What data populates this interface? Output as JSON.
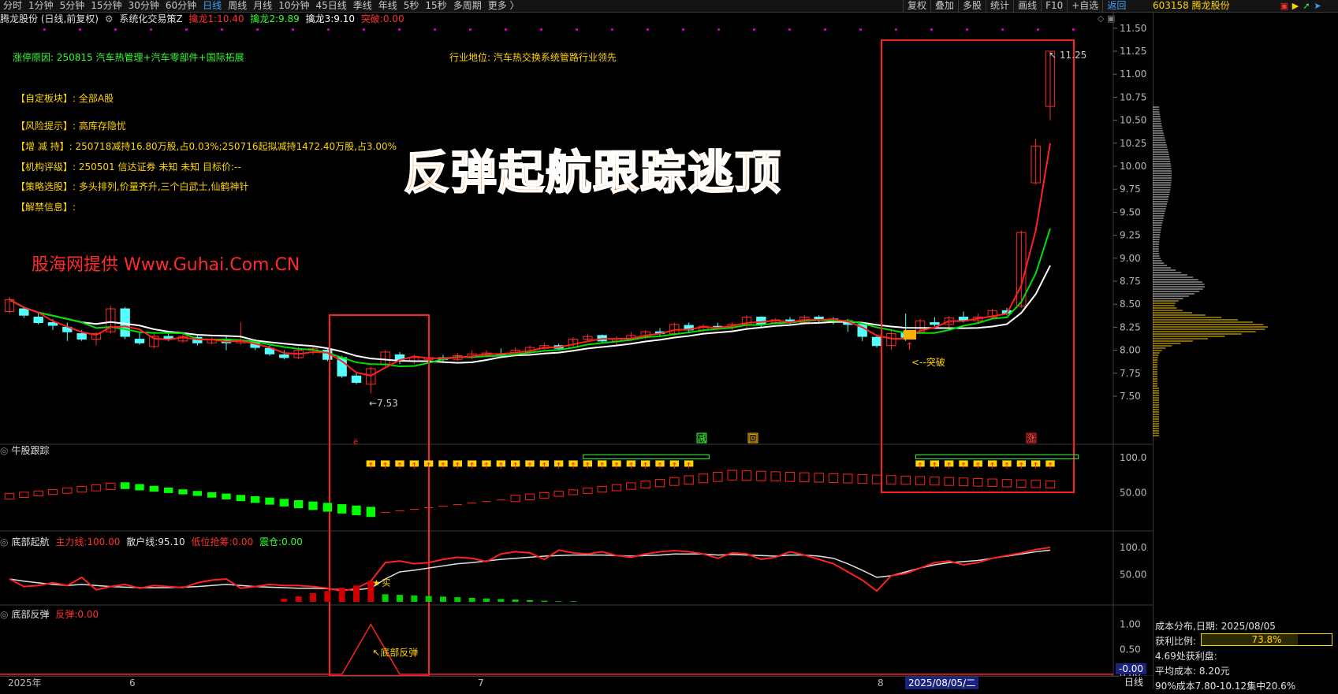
{
  "toolbar": {
    "periods": [
      "分时",
      "1分钟",
      "5分钟",
      "15分钟",
      "30分钟",
      "60分钟",
      "日线",
      "周线",
      "月线",
      "10分钟",
      "45日线",
      "季线",
      "年线",
      "5秒",
      "15秒",
      "多周期",
      "更多 〉"
    ],
    "active_period": "日线",
    "buttons": [
      "复权",
      "叠加",
      "多股",
      "统计",
      "画线",
      "F10",
      "+自选",
      "返回"
    ],
    "stock_code": "603158 腾龙股份"
  },
  "header": {
    "stock": "腾龙股份 (日线,前复权)",
    "formula": "系统化交易策Z",
    "l1_label": "擒龙1:",
    "l1_value": "10.40",
    "l2_label": "擒龙2:",
    "l2_value": "9.89",
    "l3_label": "擒龙3:",
    "l3_value": "9.10",
    "break_label": "突破:",
    "break_value": "0.00"
  },
  "info": {
    "reason": "涨停原因: 250815 汽车热管理+汽车零部件+国际拓展",
    "industry": "行业地位: 汽车热交换系统管路行业领先",
    "sector_label": "【自定板块】:",
    "sector": "全部A股",
    "risk_label": "【风险提示】:",
    "risk": "高库存隐忧",
    "holding_label": "【增 减 持】:",
    "holding": "250718减持16.80万股,占0.03%;250716起拟减持1472.40万股,占3.00%",
    "rating_label": "【机构评级】:",
    "rating": "250501 信达证券 未知 未知 目标价:--",
    "strategy_label": "【策略选股】:",
    "strategy": "多头排列,价量齐升,三个白武士,仙鹤神针",
    "unlock_label": "【解禁信息】:",
    "unlock": ""
  },
  "big_title": "反弹起航跟踪逃顶",
  "watermark": "股海网提供 Www.Guhai.Com.CN",
  "annotations": {
    "low": "←7.53",
    "high": "11.25",
    "breakout": "<--突破",
    "sig_reduce": "减",
    "sig_hui": "回",
    "sig_rise": "涨",
    "bottom_buy": "买",
    "bottom_rebound": "底部反弹"
  },
  "price_axis": [
    "11.50",
    "11.25",
    "11.00",
    "10.75",
    "10.50",
    "10.25",
    "10.00",
    "9.75",
    "9.50",
    "9.25",
    "9.00",
    "8.75",
    "8.50",
    "8.25",
    "8.00",
    "7.75",
    "7.50"
  ],
  "panels": {
    "p2": {
      "title": "牛股跟踪",
      "axis": [
        "100.0",
        "50.00"
      ]
    },
    "p3": {
      "title": "底部起航",
      "main_label": "主力线:",
      "main_value": "100.00",
      "retail_label": "散户线:",
      "retail_value": "95.10",
      "low_label": "低位抢筹:",
      "low_value": "0.00",
      "shake_label": "震仓:",
      "shake_value": "0.00",
      "axis": [
        "100.0",
        "50.00"
      ]
    },
    "p4": {
      "title": "底部反弹",
      "rebound_label": "反弹:",
      "rebound_value": "0.00",
      "axis": [
        "1.00",
        "0.50",
        "0.00"
      ]
    }
  },
  "current_value": "-0.00",
  "dates": {
    "d1": "2025年",
    "d2": "6",
    "d3": "7",
    "d4": "8",
    "selected": "2025/08/05/二",
    "timeframe": "日线"
  },
  "cost": {
    "title": "成本分布,日期:",
    "date": "2025/08/05",
    "profit_label": "获利比例:",
    "profit_value": "73.8%",
    "profit_ratio": 0.738,
    "profit_line": "4.69处获利盘:",
    "avg_label": "平均成本:",
    "avg_value": "8.20元",
    "range_line": "90%成本7.80-10.12集中20.6%"
  },
  "colors": {
    "up": "#ff2b2b",
    "down": "#54ffff",
    "ma_white": "#ffffff",
    "ma_green": "#00e000",
    "ma_red": "#ff2020",
    "yellow": "#ffd400",
    "green_bar": "#00ff00"
  },
  "price_ylim": [
    7.2,
    11.55
  ],
  "candles": [
    [
      8.42,
      8.55,
      8.58,
      8.4
    ],
    [
      8.45,
      8.38,
      8.47,
      8.35
    ],
    [
      8.36,
      8.3,
      8.4,
      8.28
    ],
    [
      8.3,
      8.27,
      8.34,
      8.22
    ],
    [
      8.25,
      8.2,
      8.3,
      8.1
    ],
    [
      8.18,
      8.12,
      8.22,
      8.1
    ],
    [
      8.12,
      8.18,
      8.2,
      8.05
    ],
    [
      8.2,
      8.45,
      8.48,
      8.18
    ],
    [
      8.45,
      8.15,
      8.47,
      8.12
    ],
    [
      8.12,
      8.08,
      8.2,
      8.06
    ],
    [
      8.04,
      8.15,
      8.18,
      8.02
    ],
    [
      8.15,
      8.12,
      8.18,
      8.1
    ],
    [
      8.1,
      8.15,
      8.18,
      8.08
    ],
    [
      8.14,
      8.08,
      8.16,
      8.05
    ],
    [
      8.08,
      8.12,
      8.14,
      8.06
    ],
    [
      8.12,
      8.08,
      8.15,
      8.0
    ],
    [
      8.08,
      8.1,
      8.3,
      8.06
    ],
    [
      8.1,
      8.03,
      8.12,
      8.0
    ],
    [
      8.02,
      7.96,
      8.05,
      7.94
    ],
    [
      7.95,
      7.92,
      8.0,
      7.9
    ],
    [
      7.92,
      8.0,
      8.04,
      7.9
    ],
    [
      8.0,
      8.02,
      8.05,
      7.95
    ],
    [
      8.0,
      7.9,
      8.02,
      7.88
    ],
    [
      7.92,
      7.72,
      7.94,
      7.7
    ],
    [
      7.72,
      7.65,
      7.75,
      7.63
    ],
    [
      7.63,
      7.8,
      7.82,
      7.53
    ],
    [
      7.85,
      7.98,
      8.0,
      7.82
    ],
    [
      7.95,
      7.9,
      7.98,
      7.85
    ],
    [
      7.88,
      7.92,
      7.95,
      7.85
    ],
    [
      7.9,
      7.92,
      7.96,
      7.88
    ],
    [
      7.92,
      7.9,
      7.95,
      7.86
    ],
    [
      7.9,
      7.94,
      7.97,
      7.88
    ],
    [
      7.93,
      7.96,
      8.0,
      7.9
    ],
    [
      7.95,
      7.97,
      8.0,
      7.92
    ],
    [
      7.96,
      7.95,
      8.02,
      7.92
    ],
    [
      7.95,
      8.0,
      8.03,
      7.94
    ],
    [
      7.98,
      8.03,
      8.05,
      7.96
    ],
    [
      8.02,
      8.05,
      8.08,
      8.0
    ],
    [
      8.05,
      8.02,
      8.07,
      8.0
    ],
    [
      8.03,
      8.12,
      8.14,
      8.02
    ],
    [
      8.12,
      8.15,
      8.18,
      8.1
    ],
    [
      8.16,
      8.1,
      8.17,
      8.08
    ],
    [
      8.1,
      8.12,
      8.15,
      8.06
    ],
    [
      8.12,
      8.16,
      8.2,
      8.1
    ],
    [
      8.15,
      8.2,
      8.22,
      8.12
    ],
    [
      8.2,
      8.18,
      8.24,
      8.15
    ],
    [
      8.18,
      8.28,
      8.3,
      8.16
    ],
    [
      8.27,
      8.22,
      8.3,
      8.2
    ],
    [
      8.22,
      8.26,
      8.28,
      8.2
    ],
    [
      8.26,
      8.25,
      8.3,
      8.22
    ],
    [
      8.25,
      8.28,
      8.3,
      8.22
    ],
    [
      8.28,
      8.36,
      8.38,
      8.24
    ],
    [
      8.36,
      8.28,
      8.37,
      8.25
    ],
    [
      8.3,
      8.33,
      8.35,
      8.28
    ],
    [
      8.33,
      8.3,
      8.36,
      8.28
    ],
    [
      8.3,
      8.36,
      8.38,
      8.28
    ],
    [
      8.36,
      8.33,
      8.38,
      8.3
    ],
    [
      8.34,
      8.32,
      8.36,
      8.28
    ],
    [
      8.32,
      8.28,
      8.34,
      8.2
    ],
    [
      8.28,
      8.15,
      8.3,
      8.1
    ],
    [
      8.14,
      8.05,
      8.16,
      8.03
    ],
    [
      8.05,
      8.18,
      8.22,
      8.0
    ],
    [
      8.2,
      8.14,
      8.4,
      8.1
    ],
    [
      8.2,
      8.32,
      8.34,
      8.18
    ],
    [
      8.3,
      8.28,
      8.36,
      8.26
    ],
    [
      8.28,
      8.35,
      8.37,
      8.25
    ],
    [
      8.36,
      8.32,
      8.42,
      8.3
    ],
    [
      8.32,
      8.36,
      8.4,
      8.3
    ],
    [
      8.36,
      8.43,
      8.45,
      8.34
    ],
    [
      8.43,
      8.4,
      8.46,
      8.38
    ],
    [
      8.48,
      9.28,
      9.3,
      8.46
    ],
    [
      9.82,
      10.22,
      10.3,
      9.8
    ],
    [
      10.65,
      11.25,
      11.25,
      10.5
    ]
  ]
}
